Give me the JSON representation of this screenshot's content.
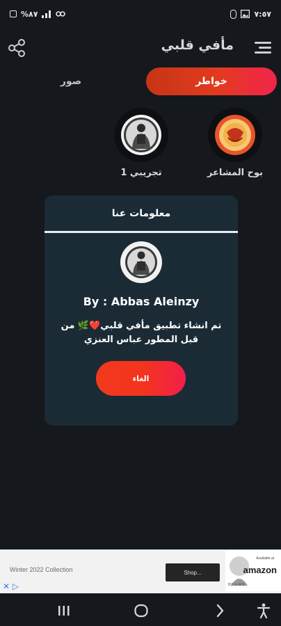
{
  "status_bar": {
    "left_text": "%٨٧",
    "right_text": "٧:٥٧"
  },
  "app_bar": {
    "title": "مأفي قلبي"
  },
  "tabs": [
    {
      "label": "خواطر",
      "active": true
    },
    {
      "label": "صور",
      "active": false
    }
  ],
  "categories": [
    {
      "label": "بوح المشاعر",
      "icon": "category-emblem-icon"
    },
    {
      "label": "تجريبي 1",
      "icon": "person-photo-icon"
    }
  ],
  "dialog": {
    "title": "معلومات عنا",
    "byline": "By : Abbas Aleinzy",
    "description": "تم انشاء تطبيق مأفي قلبي❤️🌿 من قبل المطور عباس العنزي",
    "cancel_label": "الغاء"
  },
  "ad": {
    "text": "Winter 2022 Collection",
    "button_label": "Shop...",
    "brand": "amazon",
    "brand_small": "Available at",
    "caption": "BIT in APE"
  },
  "colors": {
    "background": "#15181d",
    "accent_start": "#c63515",
    "accent_end": "#f2244c",
    "dialog_bg": "#1b2b35"
  }
}
